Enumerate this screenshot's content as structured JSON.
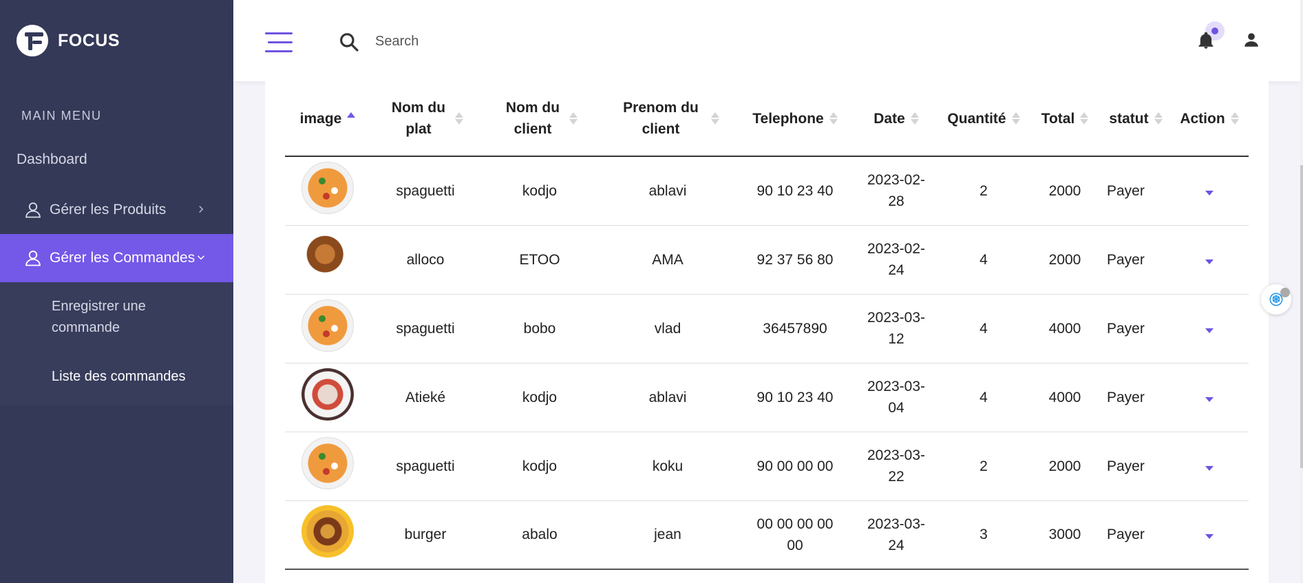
{
  "brand": {
    "name": "FOCUS"
  },
  "sidebar": {
    "heading": "MAIN MENU",
    "dashboard": "Dashboard",
    "products": "Gérer les Produits",
    "orders": "Gérer les Commandes",
    "submenu": {
      "register": "Enregistrer une commande",
      "list": "Liste des commandes"
    }
  },
  "header": {
    "search_placeholder": "Search"
  },
  "table": {
    "columns": [
      "image",
      "Nom du plat",
      "Nom du client",
      "Prenom du client",
      "Telephone",
      "Date",
      "Quantité",
      "Total",
      "statut",
      "Action"
    ],
    "rows": [
      {
        "image": "spaghetti-plate",
        "plat": "spaguetti",
        "client": "kodjo",
        "prenom": "ablavi",
        "telephone": "90 10 23 40",
        "date": "2023-02-28",
        "quantite": "2",
        "total": "2000",
        "statut": "Payer"
      },
      {
        "image": "alloco-plate",
        "plat": "alloco",
        "client": "ETOO",
        "prenom": "AMA",
        "telephone": "92 37 56 80",
        "date": "2023-02-24",
        "quantite": "4",
        "total": "2000",
        "statut": "Payer"
      },
      {
        "image": "spaghetti-plate",
        "plat": "spaguetti",
        "client": "bobo",
        "prenom": "vlad",
        "telephone": "36457890",
        "date": "2023-03-12",
        "quantite": "4",
        "total": "4000",
        "statut": "Payer"
      },
      {
        "image": "atieke-plate",
        "plat": "Atieké",
        "client": "kodjo",
        "prenom": "ablavi",
        "telephone": "90 10 23 40",
        "date": "2023-03-04",
        "quantite": "4",
        "total": "4000",
        "statut": "Payer"
      },
      {
        "image": "spaghetti-plate",
        "plat": "spaguetti",
        "client": "kodjo",
        "prenom": "koku",
        "telephone": "90 00 00 00",
        "date": "2023-03-22",
        "quantite": "2",
        "total": "2000",
        "statut": "Payer"
      },
      {
        "image": "burger-plate",
        "plat": "burger",
        "client": "abalo",
        "prenom": "jean",
        "telephone": "00 00 00 00 00",
        "date": "2023-03-24",
        "quantite": "3",
        "total": "3000",
        "statut": "Payer"
      }
    ]
  },
  "colors": {
    "accent": "#7458e8",
    "sidebar": "#343957"
  },
  "icons": [
    "logo-icon",
    "person-icon",
    "chevron-right-icon",
    "chevron-down-icon",
    "menu-icon",
    "search-icon",
    "bell-icon",
    "user-icon",
    "sort-icon",
    "caret-down-icon",
    "assistant-icon"
  ]
}
